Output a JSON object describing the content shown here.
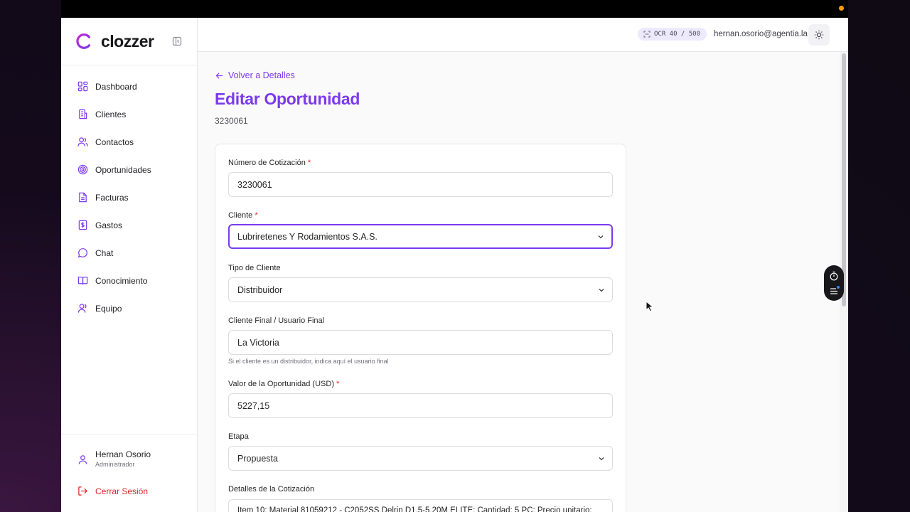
{
  "brand": {
    "name": "clozzer",
    "accent": "#7c3aed"
  },
  "sidebar": {
    "items": [
      {
        "label": "Dashboard",
        "icon": "dashboard-icon"
      },
      {
        "label": "Clientes",
        "icon": "building-icon"
      },
      {
        "label": "Contactos",
        "icon": "users-icon"
      },
      {
        "label": "Oportunidades",
        "icon": "target-icon"
      },
      {
        "label": "Facturas",
        "icon": "document-icon"
      },
      {
        "label": "Gastos",
        "icon": "dollar-receipt-icon"
      },
      {
        "label": "Chat",
        "icon": "chat-bubble-icon"
      },
      {
        "label": "Conocimiento",
        "icon": "book-icon"
      },
      {
        "label": "Equipo",
        "icon": "team-icon"
      }
    ],
    "user": {
      "name": "Hernan Osorio",
      "role": "Administrador"
    },
    "logout_label": "Cerrar Sesión"
  },
  "header": {
    "ocr_label": "OCR 40 / 500",
    "email": "hernan.osorio@agentia.la"
  },
  "main": {
    "back_label": "Volver a Detalles",
    "title": "Editar Oportunidad",
    "subtitle": "3230061",
    "form": {
      "quote_number": {
        "label": "Número de Cotización",
        "required": "*",
        "value": "3230061"
      },
      "client": {
        "label": "Cliente",
        "required": "*",
        "value": "Lubriretenes Y Rodamientos S.A.S."
      },
      "client_type": {
        "label": "Tipo de Cliente",
        "value": "Distribuidor"
      },
      "end_client": {
        "label": "Cliente Final / Usuario Final",
        "value": "La Victoria",
        "hint": "Si el cliente es un distribuidor, indica aquí el usuario final"
      },
      "opportunity_value": {
        "label": "Valor de la Oportunidad (USD)",
        "required": "*",
        "value": "5227,15"
      },
      "stage": {
        "label": "Etapa",
        "value": "Propuesta"
      },
      "quote_details": {
        "label": "Detalles de la Cotización",
        "value": "Item 10: Material 81059212 - C2052SS Delrin D1.5-5.20M ELITE; Cantidad: 5 PC; Precio unitario:"
      }
    }
  }
}
